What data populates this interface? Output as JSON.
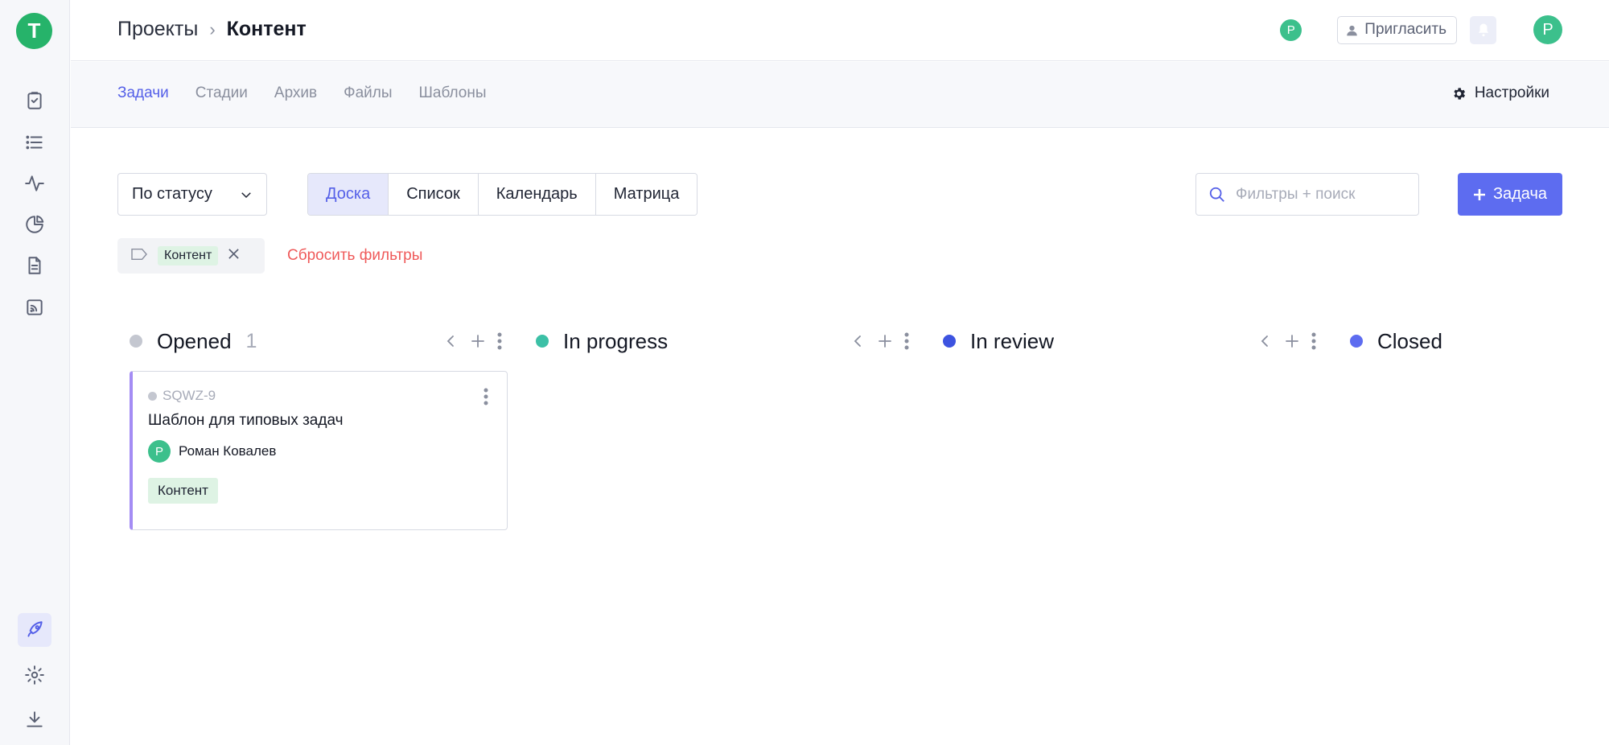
{
  "workspace": {
    "initial": "T"
  },
  "breadcrumb": {
    "parent": "Проекты",
    "separator": "›",
    "current": "Контент"
  },
  "header": {
    "member_initial": "Р",
    "invite_label": "Пригласить",
    "user_initial": "Р"
  },
  "subnav": {
    "tabs": [
      {
        "label": "Задачи",
        "active": true
      },
      {
        "label": "Стадии"
      },
      {
        "label": "Архив"
      },
      {
        "label": "Файлы"
      },
      {
        "label": "Шаблоны"
      }
    ],
    "settings_label": "Настройки"
  },
  "toolbar": {
    "group_by": "По статусу",
    "views": [
      {
        "label": "Доска",
        "active": true
      },
      {
        "label": "Список"
      },
      {
        "label": "Календарь"
      },
      {
        "label": "Матрица"
      }
    ],
    "search_placeholder": "Фильтры + поиск",
    "add_task_label": "Задача"
  },
  "filters": {
    "active_tag": "Контент",
    "reset_label": "Сбросить фильтры"
  },
  "columns": [
    {
      "title": "Opened",
      "count": "1",
      "color": "#c4c7d0"
    },
    {
      "title": "In progress",
      "count": "",
      "color": "#3cc0a6"
    },
    {
      "title": "In review",
      "count": "",
      "color": "#3d53e0"
    },
    {
      "title": "Closed",
      "count": "",
      "color": "#5d6cf0"
    }
  ],
  "card": {
    "key": "SQWZ-9",
    "title": "Шаблон для типовых задач",
    "assignee_initial": "Р",
    "assignee_name": "Роман Ковалев",
    "tag": "Контент",
    "accent_color": "#a48cf4"
  },
  "colors": {
    "accent": "#5d6cf0",
    "brand": "#26b36a",
    "danger": "#ef5a5a"
  }
}
